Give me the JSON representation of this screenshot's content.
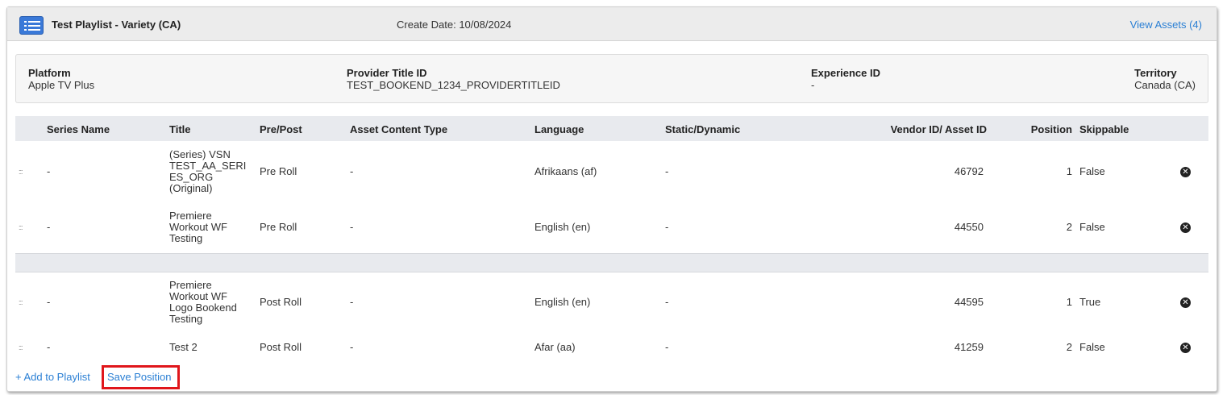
{
  "header": {
    "title": "Test Playlist - Variety (CA)",
    "create_date": "Create Date: 10/08/2024",
    "view_assets": "View Assets (4)",
    "icon": "playlist-icon"
  },
  "info": {
    "platform_label": "Platform",
    "platform_value": "Apple TV Plus",
    "provider_label": "Provider Title ID",
    "provider_value": "TEST_BOOKEND_1234_PROVIDERTITLEID",
    "experience_label": "Experience ID",
    "experience_value": "-",
    "territory_label": "Territory",
    "territory_value": "Canada (CA)"
  },
  "table": {
    "columns": [
      "Series Name",
      "Title",
      "Pre/Post",
      "Asset Content Type",
      "Language",
      "Static/Dynamic",
      "Vendor ID/ Asset ID",
      "Position",
      "Skippable"
    ],
    "pre_rows": [
      {
        "handle": ":::",
        "series": "-",
        "title_lines": [
          "(Series) VSN",
          "TEST_AA_SERI",
          "ES_ORG",
          "(Original)"
        ],
        "prepost": "Pre Roll",
        "content_type": "-",
        "language": "Afrikaans (af)",
        "static_dynamic": "-",
        "vendor_id": "46792",
        "position": "1",
        "skippable": "False"
      },
      {
        "handle": ":::",
        "series": "-",
        "title_lines": [
          "Premiere",
          "Workout WF",
          "Testing"
        ],
        "prepost": "Pre Roll",
        "content_type": "-",
        "language": "English (en)",
        "static_dynamic": "-",
        "vendor_id": "44550",
        "position": "2",
        "skippable": "False"
      }
    ],
    "post_rows": [
      {
        "handle": ":::",
        "series": "-",
        "title_lines": [
          "Premiere",
          "Workout WF",
          "Logo Bookend",
          "Testing"
        ],
        "prepost": "Post Roll",
        "content_type": "-",
        "language": "English (en)",
        "static_dynamic": "-",
        "vendor_id": "44595",
        "position": "1",
        "skippable": "True"
      },
      {
        "handle": ":::",
        "series": "-",
        "title_lines": [
          "Test 2"
        ],
        "prepost": "Post Roll",
        "content_type": "-",
        "language": "Afar (aa)",
        "static_dynamic": "-",
        "vendor_id": "41259",
        "position": "2",
        "skippable": "False"
      }
    ]
  },
  "footer": {
    "add_to_playlist": "+ Add to Playlist",
    "save_position": "Save Position"
  },
  "colors": {
    "link": "#2a7fd4",
    "highlight": "#e0161b",
    "icon_blue": "#3a79d8"
  }
}
